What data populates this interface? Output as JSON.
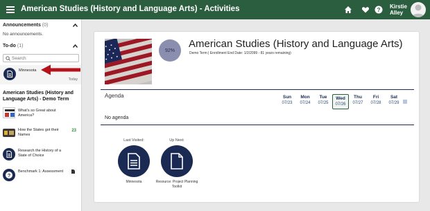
{
  "topbar": {
    "title": "American Studies (History and Language Arts) - Activities",
    "user_first": "Kirstie",
    "user_last": "Alley",
    "bg_color": "#2b5d3f"
  },
  "sidebar": {
    "announcements": {
      "label": "Announcements",
      "count": "(0)",
      "empty_text": "No announcements."
    },
    "todo": {
      "label": "To-do",
      "count": "(1)",
      "search_placeholder": "Search",
      "items": [
        {
          "title": "Minnesota",
          "date": "Today",
          "icon": "document-icon"
        }
      ]
    },
    "course": {
      "title": "American Studies (History and Language Arts) - Demo Term",
      "activities": [
        {
          "label": "What's so Great about America?",
          "icon": "thumbnail",
          "count": ""
        },
        {
          "label": "How the States got their Names",
          "icon": "thumbnail",
          "count": "23"
        },
        {
          "label": "Research the History of a State of Choice",
          "icon": "document-icon",
          "count": ""
        },
        {
          "label": "Benchmark 1: Assessment",
          "icon": "question-icon",
          "count": ""
        }
      ]
    }
  },
  "main": {
    "course_title": "American Studies (History and Language Arts)",
    "course_sub": "Demo Term | Enrollment End Date: 1/2/2099 - 81 years remaining)",
    "progress": "92%",
    "agenda_label": "Agenda",
    "no_agenda": "No agenda",
    "days": [
      {
        "name": "Sun",
        "date": "07/23"
      },
      {
        "name": "Mon",
        "date": "07/24"
      },
      {
        "name": "Tue",
        "date": "07/25"
      },
      {
        "name": "Wed",
        "date": "07/26",
        "today": true
      },
      {
        "name": "Thu",
        "date": "07/27"
      },
      {
        "name": "Fri",
        "date": "07/28"
      },
      {
        "name": "Sat",
        "date": "07/29"
      }
    ],
    "last_visited": {
      "label": "Last Visited:",
      "name": "Minnesota"
    },
    "up_next": {
      "label": "Up Next:",
      "name": "Resource: Project Planning Toolkit"
    }
  },
  "colors": {
    "navy": "#1b2a52",
    "green": "#2b5d3f",
    "arrow": "#b5121b"
  }
}
